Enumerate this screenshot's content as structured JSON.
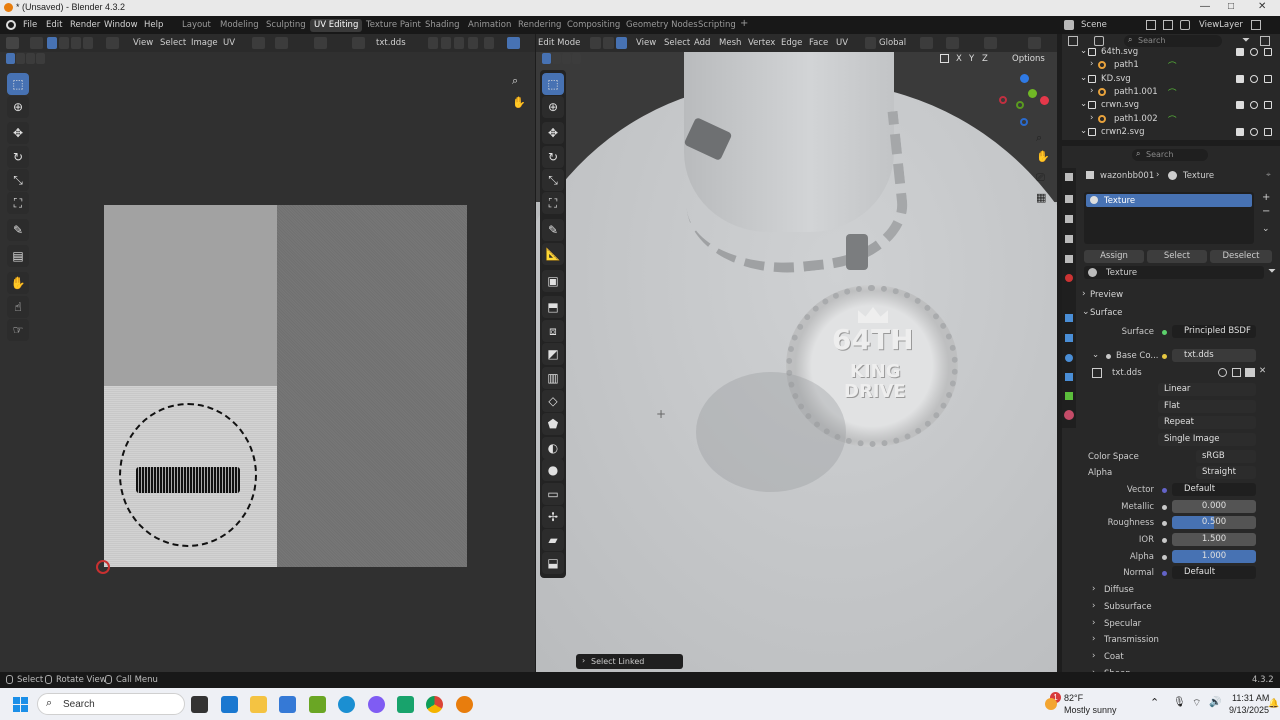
{
  "window": {
    "title": "* (Unsaved) - Blender 4.3.2",
    "min": "—",
    "max": "□",
    "close": "✕"
  },
  "menu": [
    "File",
    "Edit",
    "Render",
    "Window",
    "Help"
  ],
  "workspaces": [
    "Layout",
    "Modeling",
    "Sculpting",
    "UV Editing",
    "Texture Paint",
    "Shading",
    "Animation",
    "Rendering",
    "Compositing",
    "Geometry Nodes",
    "Scripting"
  ],
  "workspace_add": "+",
  "scene": {
    "scene_label": "Scene",
    "viewlayer_label": "ViewLayer"
  },
  "uv_header": {
    "view": "View",
    "select": "Select",
    "image": "Image",
    "uv": "UV",
    "image_name": "txt.dds"
  },
  "v3d_header": {
    "mode": "Edit Mode",
    "view": "View",
    "select": "Select",
    "add": "Add",
    "mesh": "Mesh",
    "vertex": "Vertex",
    "edge": "Edge",
    "face": "Face",
    "uv": "UV",
    "orientation": "Global",
    "options": "Options",
    "axes": [
      "X",
      "Y",
      "Z"
    ]
  },
  "pendant": {
    "line1": "64TH",
    "line2": "KING",
    "line3": "DRIVE"
  },
  "operator_panel": "Select Linked",
  "outliner": {
    "search_placeholder": "Search",
    "rows": [
      {
        "name": "64th.svg",
        "indent": 0
      },
      {
        "name": "path1",
        "indent": 1
      },
      {
        "name": "KD.svg",
        "indent": 0
      },
      {
        "name": "path1.001",
        "indent": 1
      },
      {
        "name": "crwn.svg",
        "indent": 0
      },
      {
        "name": "path1.002",
        "indent": 1
      },
      {
        "name": "crwn2.svg",
        "indent": 0
      }
    ]
  },
  "properties": {
    "search_placeholder": "Search",
    "breadcrumb_object": "wazonbb001",
    "breadcrumb_material": "Texture",
    "slot_name": "Texture",
    "assign": "Assign",
    "select": "Select",
    "deselect": "Deselect",
    "material_name": "Texture",
    "preview": "Preview",
    "surface_section": "Surface",
    "surface_label": "Surface",
    "surface_value": "Principled BSDF",
    "base_color_label": "Base Co...",
    "base_color_value": "txt.dds",
    "image_name": "txt.dds",
    "interpolation": "Linear",
    "projection": "Flat",
    "extension": "Repeat",
    "source": "Single Image",
    "color_space_label": "Color Space",
    "color_space": "sRGB",
    "alpha_mode_label": "Alpha",
    "alpha_mode": "Straight",
    "vector_label": "Vector",
    "vector_value": "Default",
    "metallic_label": "Metallic",
    "metallic_value": "0.000",
    "roughness_label": "Roughness",
    "roughness_value": "0.500",
    "ior_label": "IOR",
    "ior_value": "1.500",
    "alpha_label": "Alpha",
    "alpha_value": "1.000",
    "normal_label": "Normal",
    "normal_value": "Default",
    "subsections": [
      "Diffuse",
      "Subsurface",
      "Specular",
      "Transmission",
      "Coat",
      "Sheen"
    ]
  },
  "statusbar": {
    "select": "Select",
    "rotate": "Rotate View",
    "call_menu": "Call Menu",
    "version": "4.3.2"
  },
  "taskbar": {
    "search_placeholder": "Search",
    "weather_temp": "82°F",
    "weather_desc": "Mostly sunny",
    "time": "11:31 AM",
    "date": "9/13/2025",
    "notify": "1"
  },
  "colors": {
    "accent": "#4772b3",
    "active_ws": "#3a3a3a"
  }
}
